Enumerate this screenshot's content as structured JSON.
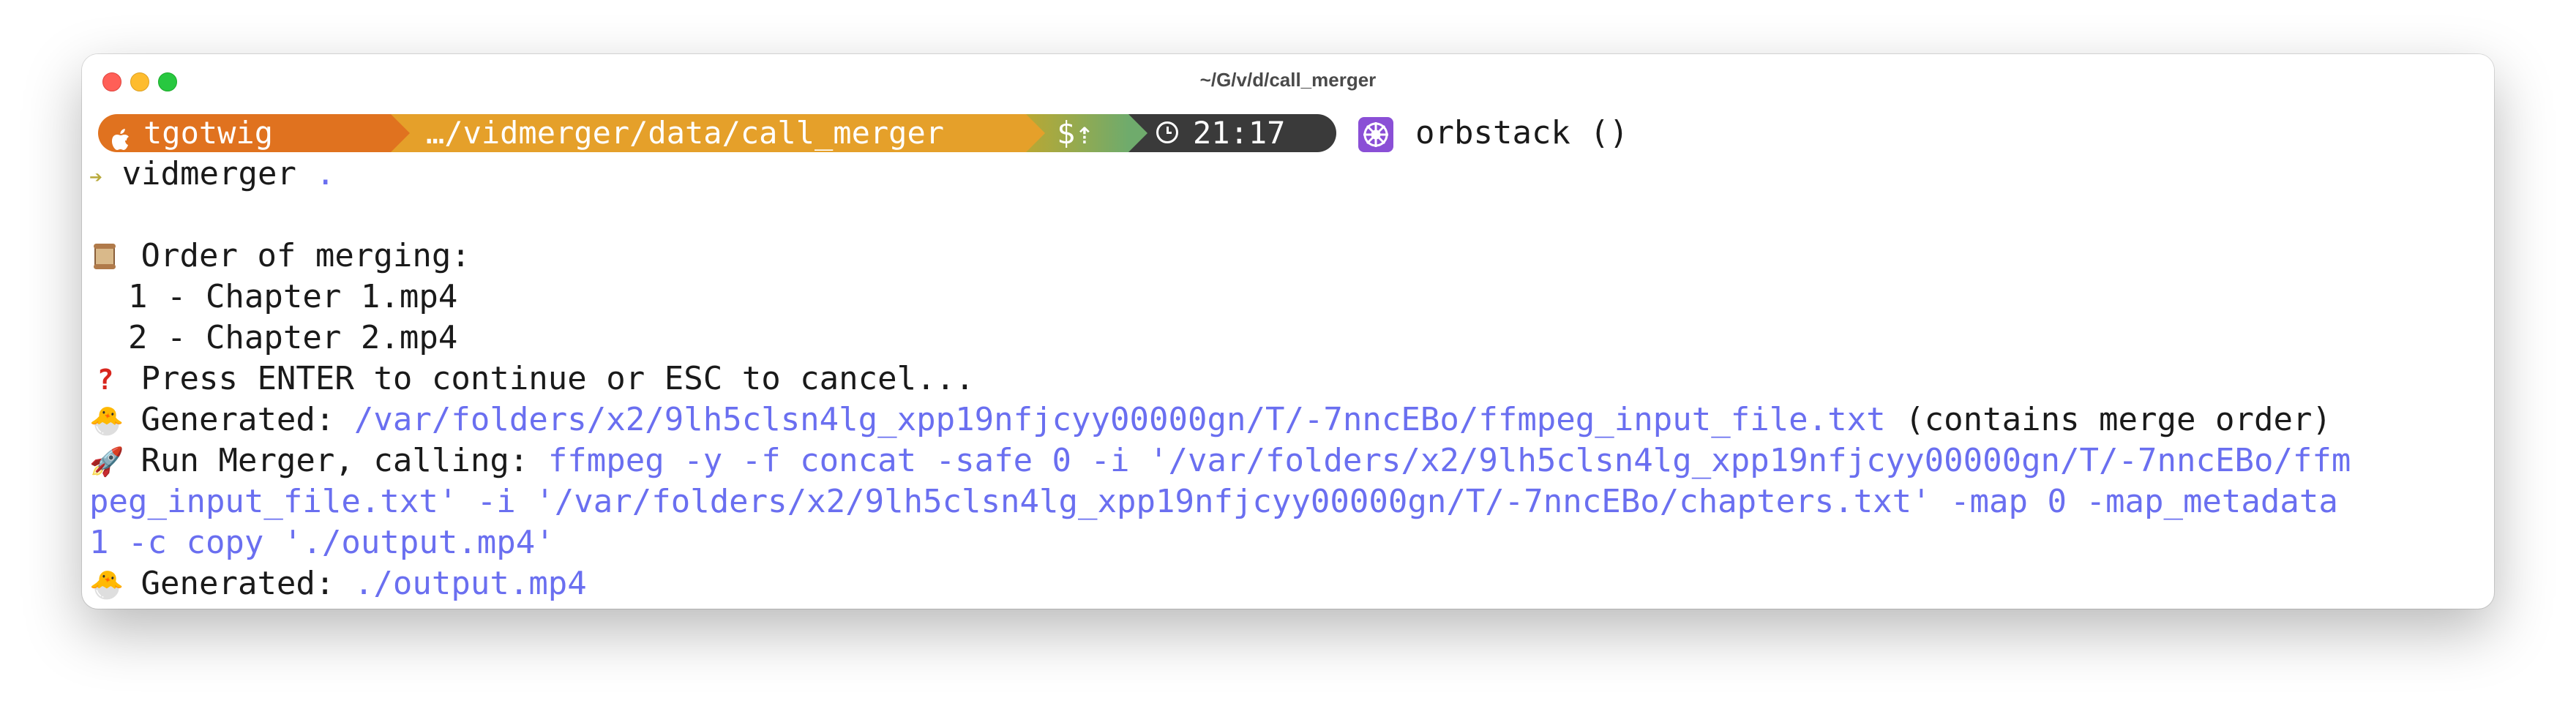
{
  "window": {
    "title": "~/G/v/d/call_merger"
  },
  "prompt": {
    "user": "tgotwig",
    "path": "…/vidmerger/data/call_merger",
    "git": "$⇡",
    "time": "21:17",
    "kube_context": "orbstack ()",
    "colors": {
      "user_bg": "#e0721f",
      "path_bg": "#e5a02a",
      "git_bg": "#6fab6c",
      "time_bg": "#3a3a3a",
      "kube_icon": "#8a4fd6"
    }
  },
  "command": {
    "arrow": "➔",
    "text": "vidmerger",
    "arg": "."
  },
  "output": {
    "order_header": "Order of merging:",
    "order_items": [
      "1 - Chapter 1.mp4",
      "2 - Chapter 2.mp4"
    ],
    "press_line": "Press ENTER to continue or ESC to cancel...",
    "generated1_label": "Generated:",
    "generated1_path": "/var/folders/x2/9lh5clsn4lg_xpp19nfjcyy00000gn/T/-7nncEBo/ffmpeg_input_file.txt",
    "generated1_suffix": "(contains merge order)",
    "run_label": "Run Merger, calling:",
    "run_cmd_line1": "ffmpeg -y -f concat -safe 0 -i '/var/folders/x2/9lh5clsn4lg_xpp19nfjcyy00000gn/T/-7nncEBo/ffm",
    "run_cmd_line2": "peg_input_file.txt' -i '/var/folders/x2/9lh5clsn4lg_xpp19nfjcyy00000gn/T/-7nncEBo/chapters.txt' -map 0 -map_metadata",
    "run_cmd_line3": "1 -c copy './output.mp4'",
    "generated2_label": "Generated:",
    "generated2_path": "./output.mp4",
    "icons": {
      "order": "scroll-icon",
      "press": "question-mark-icon",
      "generated": "hatching-chick-icon",
      "run": "rocket-icon"
    },
    "accent_color": "#6a6ff0"
  }
}
